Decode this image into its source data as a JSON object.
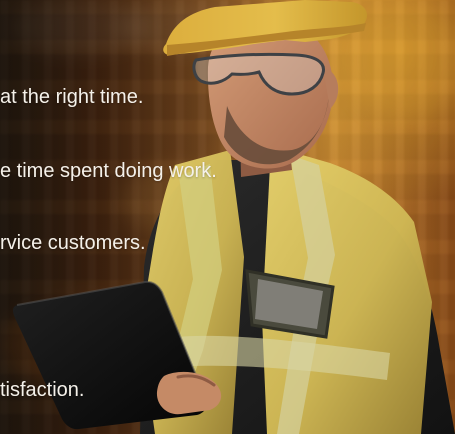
{
  "overlay_text": {
    "line_1": "at the right time.",
    "line_2": "e time spent doing work.",
    "line_3": "rvice customers.",
    "line_4": "tisfaction."
  }
}
